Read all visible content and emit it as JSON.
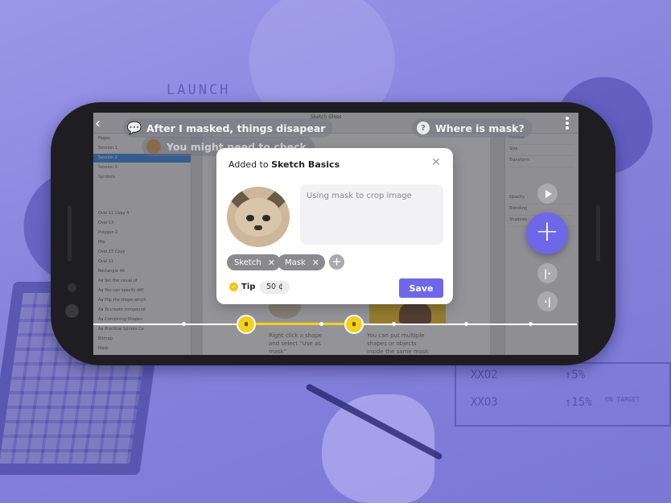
{
  "background": {
    "sketch_words": [
      "LAUNCH",
      "XXO2",
      "XXO3",
      "↑5%",
      "↑15%",
      "ON TARGET"
    ]
  },
  "comments": [
    {
      "text": "After I masked, things disapear",
      "icon": "speech-bubble-icon"
    },
    {
      "text": "You might need to check",
      "icon": "avatar"
    },
    {
      "text": "Where is mask?",
      "icon": "question-icon"
    }
  ],
  "sketch_app": {
    "window_title": "Sketch Gloss",
    "pages_label": "Pages",
    "pages": [
      "Session 1",
      "Session 2",
      "Session 3",
      "Symbols"
    ],
    "selected_page_index": 1,
    "layers": [
      "Oval 11 Copy 4",
      "Oval 13",
      "Polygon 2",
      "Mix",
      "Oval 15 Copy",
      "Oval 11",
      "Rectangle 40",
      "Aa Set the visual of",
      "Aa You can specify diff",
      "Aa Flip the shape which",
      "Aa To create compound",
      "Aa Combining Shapes",
      "Aa Practical Sprints Ca",
      "Bitmap",
      "Mask"
    ],
    "canvas_text_1": "Right click a shape and select \"Use as mask\"",
    "canvas_text_2": "You can put multiple shapes or objects inside the same mask",
    "inspector_rows": [
      "Position",
      "Size",
      "Transform",
      "Opacity",
      "Blending",
      "Shadows"
    ]
  },
  "dialog": {
    "title_prefix": "Added to",
    "title_bold": "Sketch Basics",
    "note_text": "Using mask to crop image",
    "tags": [
      "Sketch",
      "Mask"
    ],
    "tip_label": "Tip",
    "tip_value": "50 ¢",
    "save_label": "Save"
  },
  "colors": {
    "accent": "#6e68e8",
    "highlight": "#f5d21a",
    "background": "#8a87e0"
  }
}
